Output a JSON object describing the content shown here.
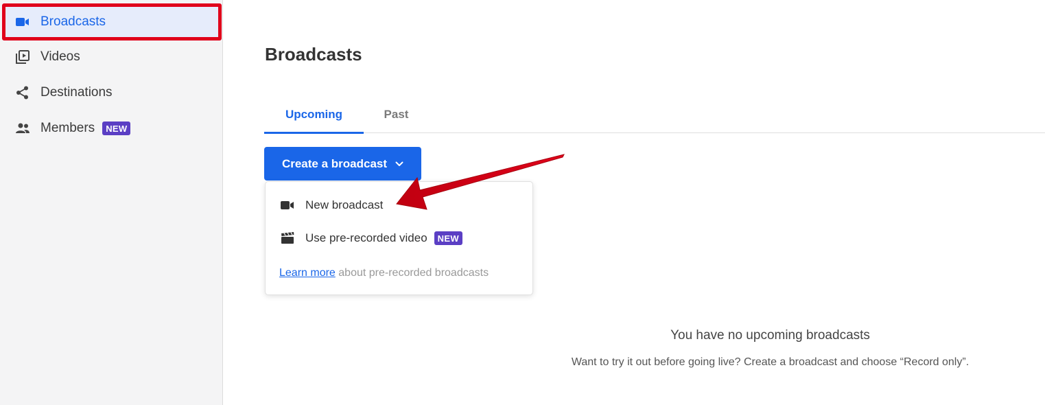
{
  "sidebar": {
    "items": [
      {
        "label": "Broadcasts",
        "icon": "video-camera-icon",
        "active": true
      },
      {
        "label": "Videos",
        "icon": "video-library-icon"
      },
      {
        "label": "Destinations",
        "icon": "share-icon"
      },
      {
        "label": "Members",
        "icon": "people-icon",
        "badge": "NEW"
      }
    ]
  },
  "main": {
    "title": "Broadcasts",
    "tabs": [
      {
        "label": "Upcoming",
        "active": true
      },
      {
        "label": "Past"
      }
    ],
    "create_button": {
      "label": "Create a broadcast",
      "icon": "chevron-down-icon"
    },
    "dropdown": {
      "items": [
        {
          "label": "New broadcast",
          "icon": "video-camera-icon"
        },
        {
          "label": "Use pre-recorded video",
          "icon": "clapperboard-icon",
          "badge": "NEW"
        }
      ],
      "learn_more_link": "Learn more",
      "learn_more_text": " about pre-recorded broadcasts"
    },
    "empty_state": {
      "title": "You have no upcoming broadcasts",
      "subtitle": "Want to try it out before going live? Create a broadcast and choose “Record only”."
    }
  },
  "colors": {
    "accent": "#1a66e8",
    "badge": "#5b3fc4",
    "annotation_red": "#e0001b",
    "sidebar_bg": "#f4f4f5"
  }
}
